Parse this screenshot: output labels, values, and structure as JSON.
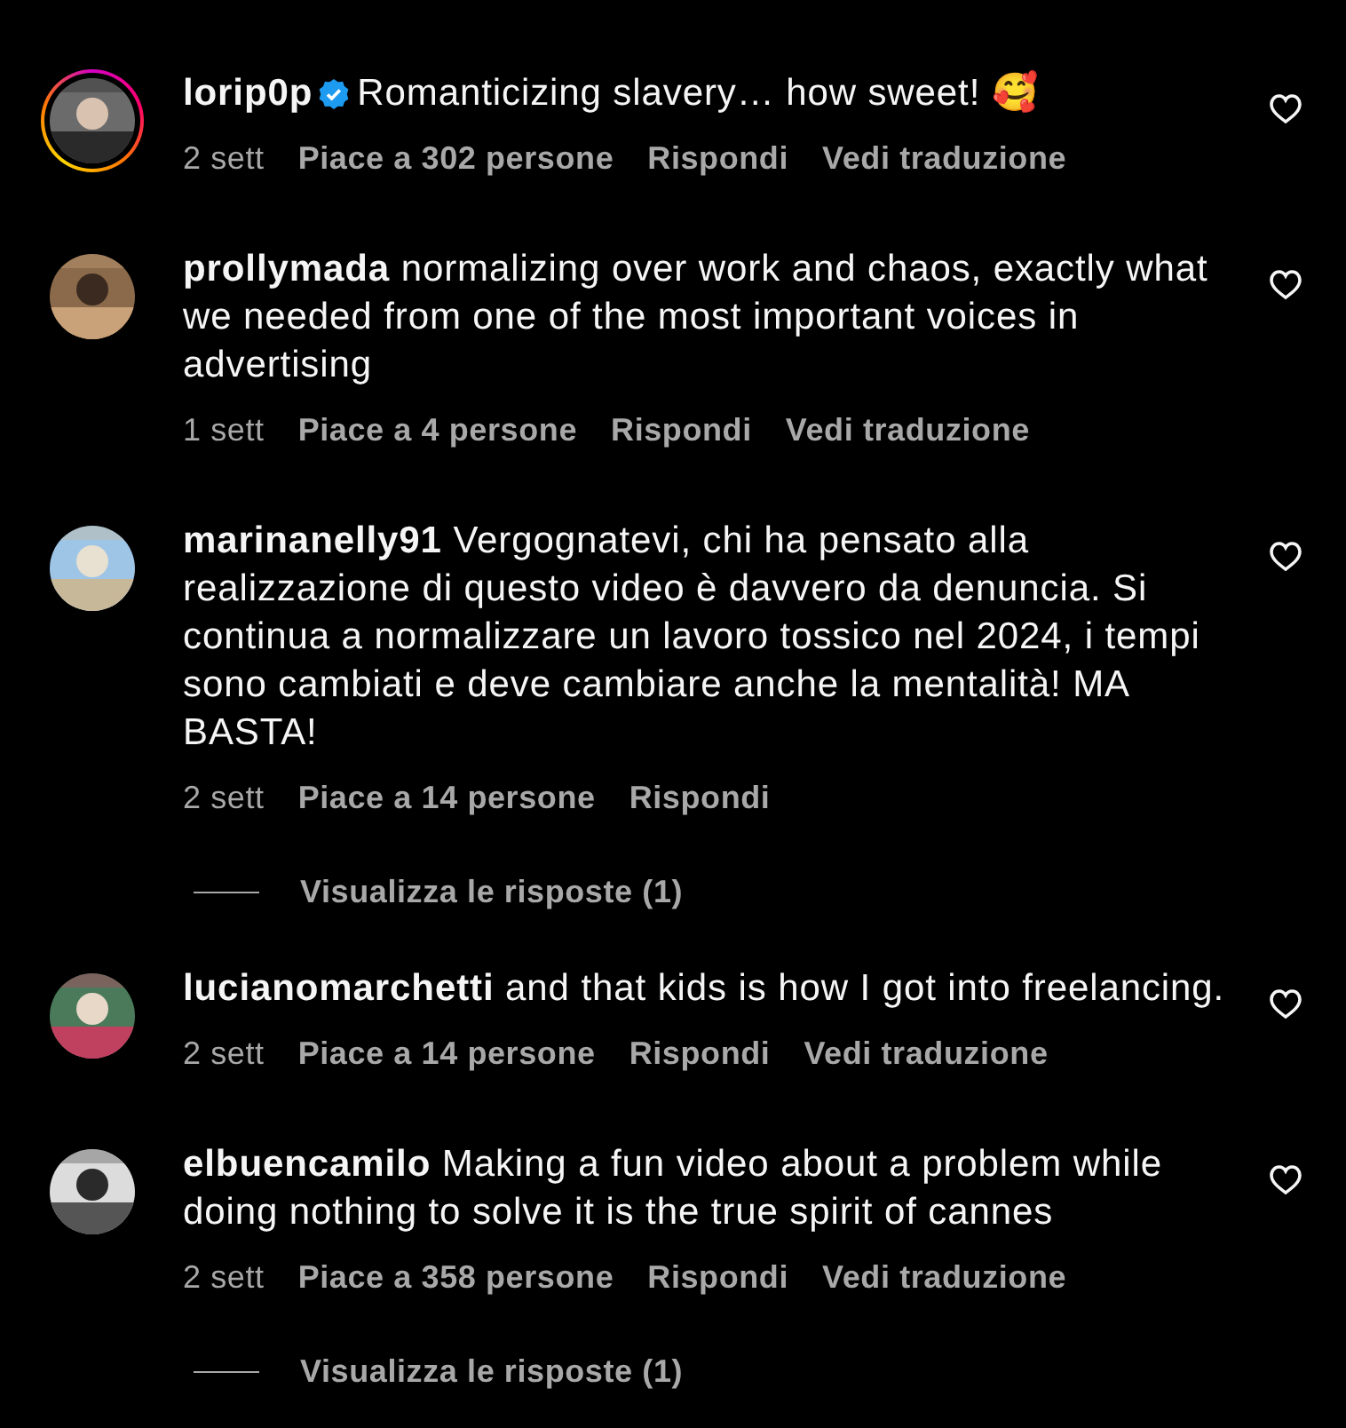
{
  "comments": [
    {
      "username": "lorip0p",
      "verified": true,
      "story_ring": true,
      "text": "Romanticizing slavery… how sweet! 🥰",
      "time": "2 sett",
      "likes": "Piace a 302 persone",
      "reply": "Rispondi",
      "translate": "Vedi traduzione",
      "liked": false
    },
    {
      "username": "prollymada",
      "verified": false,
      "story_ring": false,
      "text": "normalizing over work and chaos, exactly what we needed from one of the most important voices in advertising",
      "time": "1 sett",
      "likes": "Piace a 4 persone",
      "reply": "Rispondi",
      "translate": "Vedi traduzione",
      "liked": false
    },
    {
      "username": "marinanelly91",
      "verified": false,
      "story_ring": false,
      "text": "Vergognatevi, chi ha pensato alla realizzazione di questo video è davvero da denuncia. Si continua a normalizzare un lavoro tossico nel 2024, i tempi sono cambiati e deve cambiare anche la mentalità! MA BASTA!",
      "time": "2 sett",
      "likes": "Piace a 14 persone",
      "reply": "Rispondi",
      "liked": false,
      "view_replies": "Visualizza le risposte (1)"
    },
    {
      "username": "lucianomarchetti",
      "verified": false,
      "story_ring": false,
      "text": "and that kids is how I got into freelancing.",
      "time": "2 sett",
      "likes": "Piace a 14 persone",
      "reply": "Rispondi",
      "translate": "Vedi traduzione",
      "liked": false
    },
    {
      "username": "elbuencamilo",
      "verified": false,
      "story_ring": false,
      "text": "Making a fun video about a problem while doing nothing to solve it is the true spirit of cannes",
      "time": "2 sett",
      "likes": "Piace a 358 persone",
      "reply": "Rispondi",
      "translate": "Vedi traduzione",
      "liked": false,
      "view_replies": "Visualizza le risposte (1)"
    }
  ]
}
